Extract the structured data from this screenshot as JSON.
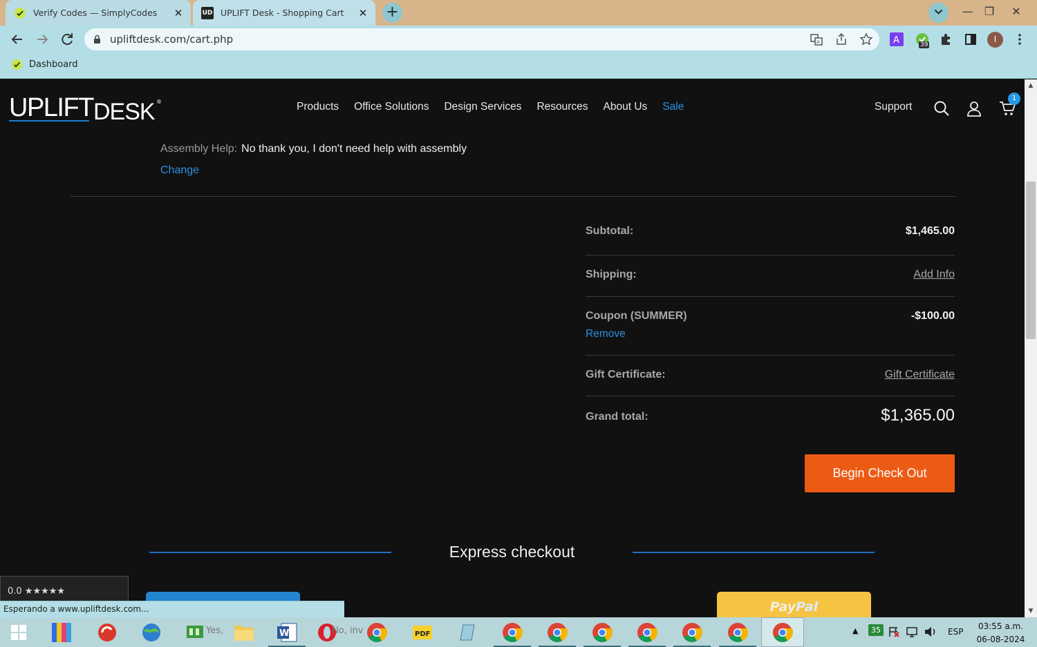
{
  "browser": {
    "tabs": [
      {
        "title": "Verify Codes — SimplyCodes",
        "favicon": "simplycodes-icon"
      },
      {
        "title": "UPLIFT Desk - Shopping Cart",
        "favicon": "uplift-desk-icon",
        "favicon_text": "UD"
      }
    ],
    "url": "upliftdesk.com/cart.php",
    "extension_badge": "39",
    "profile_initial": "I",
    "bookmark": "Dashboard"
  },
  "site": {
    "logo_part1": "UPLIFT",
    "logo_part2": "DESK",
    "logo_reg": "®",
    "nav": [
      "Products",
      "Office Solutions",
      "Design Services",
      "Resources",
      "About Us",
      "Sale"
    ],
    "support": "Support",
    "cart_count": "1"
  },
  "cart": {
    "assembly_label": "Assembly Help:",
    "assembly_value": "No thank you, I don't need help with assembly",
    "change_link": "Change",
    "subtotal_label": "Subtotal:",
    "subtotal_value": "$1,465.00",
    "shipping_label": "Shipping:",
    "shipping_link": "Add Info",
    "coupon_label": "Coupon (SUMMER)",
    "coupon_value": "-$100.00",
    "coupon_remove": "Remove",
    "gift_label": "Gift Certificate:",
    "gift_link": "Gift Certificate",
    "grand_label": "Grand total:",
    "grand_value": "$1,365.00",
    "checkout_button": "Begin Check Out",
    "express_title": "Express checkout"
  },
  "widgets": {
    "review_score": "0.0 ★★★★★",
    "paypal_part1": "Pay",
    "paypal_part2": "Pal",
    "status_text": "Esperando a www.upliftdesk.com..."
  },
  "taskbar": {
    "yes_label": "Yes,",
    "no_label": "No, inv",
    "tray_count": "35",
    "language": "ESP",
    "time": "03:55 a.m.",
    "date": "06-08-2024"
  },
  "colors": {
    "accent_blue": "#2d8fe0",
    "checkout_orange": "#ec5b14",
    "page_bg": "#111112",
    "paypal_yellow": "#f6c343"
  }
}
